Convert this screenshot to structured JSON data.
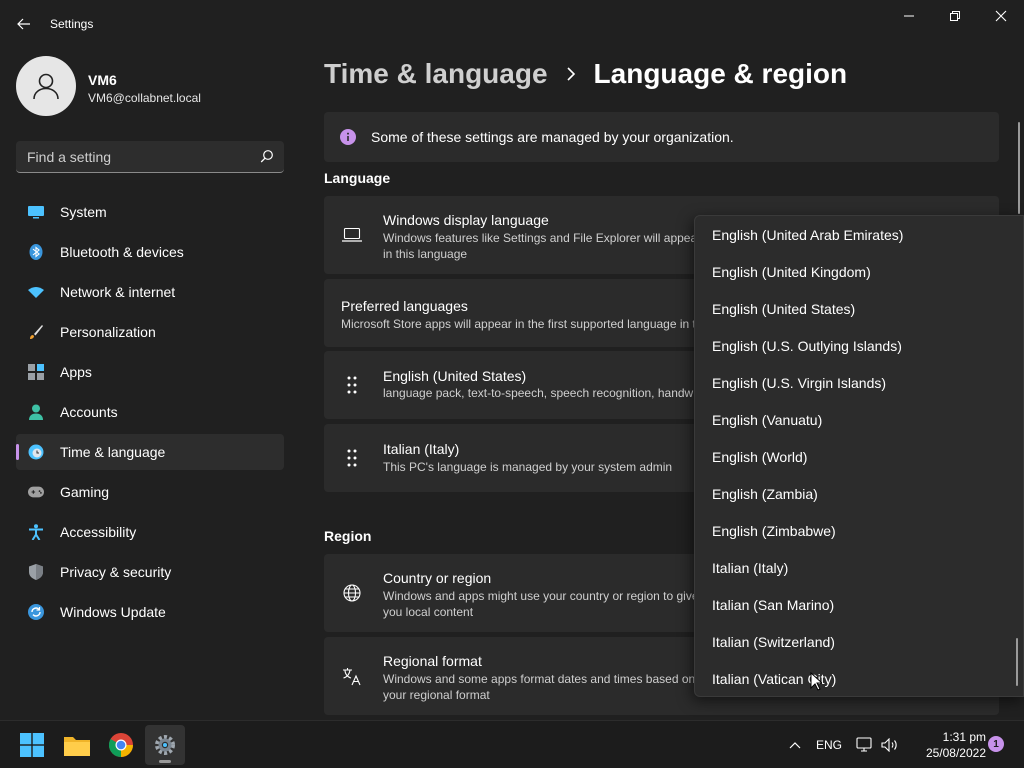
{
  "window": {
    "title": "Settings"
  },
  "user": {
    "name": "VM6",
    "email": "VM6@collabnet.local"
  },
  "search": {
    "placeholder": "Find a setting"
  },
  "sidebar": {
    "items": [
      {
        "label": "System",
        "icon": "monitor-icon",
        "active": false
      },
      {
        "label": "Bluetooth & devices",
        "icon": "bluetooth-icon",
        "active": false
      },
      {
        "label": "Network & internet",
        "icon": "wifi-icon",
        "active": false
      },
      {
        "label": "Personalization",
        "icon": "brush-icon",
        "active": false
      },
      {
        "label": "Apps",
        "icon": "apps-icon",
        "active": false
      },
      {
        "label": "Accounts",
        "icon": "person-icon",
        "active": false
      },
      {
        "label": "Time & language",
        "icon": "globe-clock-icon",
        "active": true
      },
      {
        "label": "Gaming",
        "icon": "gamepad-icon",
        "active": false
      },
      {
        "label": "Accessibility",
        "icon": "accessibility-icon",
        "active": false
      },
      {
        "label": "Privacy & security",
        "icon": "shield-icon",
        "active": false
      },
      {
        "label": "Windows Update",
        "icon": "update-icon",
        "active": false
      }
    ]
  },
  "breadcrumb": {
    "parent": "Time & language",
    "current": "Language & region"
  },
  "banner": {
    "text": "Some of these settings are managed by your organization."
  },
  "language": {
    "heading": "Language",
    "display_language": {
      "title": "Windows display language",
      "desc": "Windows features like Settings and File Explorer will appear in this language"
    },
    "preferred": {
      "title": "Preferred languages",
      "desc": "Microsoft Store apps will appear in the first supported language in this list"
    },
    "languages": [
      {
        "title": "English (United States)",
        "desc": "language pack, text-to-speech, speech recognition, handwriting, basic typing"
      },
      {
        "title": "Italian (Italy)",
        "desc": "This PC's language is managed by your system admin"
      }
    ]
  },
  "region": {
    "heading": "Region",
    "country": {
      "title": "Country or region",
      "desc": "Windows and apps might use your country or region to give you local content"
    },
    "format": {
      "title": "Regional format",
      "desc": "Windows and some apps format dates and times based on your regional format"
    }
  },
  "dropdown": {
    "options": [
      "English (United Arab Emirates)",
      "English (United Kingdom)",
      "English (United States)",
      "English (U.S. Outlying Islands)",
      "English (U.S. Virgin Islands)",
      "English (Vanuatu)",
      "English (World)",
      "English (Zambia)",
      "English (Zimbabwe)",
      "Italian (Italy)",
      "Italian (San Marino)",
      "Italian (Switzerland)",
      "Italian (Vatican City)"
    ]
  },
  "taskbar": {
    "apps": [
      "start-icon",
      "file-explorer-icon",
      "chrome-icon",
      "settings-icon"
    ],
    "language": "ENG",
    "time": "1:31 pm",
    "date": "25/08/2022",
    "notification_count": "1"
  },
  "colors": {
    "accent": "#c792ea",
    "background": "#202020",
    "card": "#2b2b2b"
  }
}
